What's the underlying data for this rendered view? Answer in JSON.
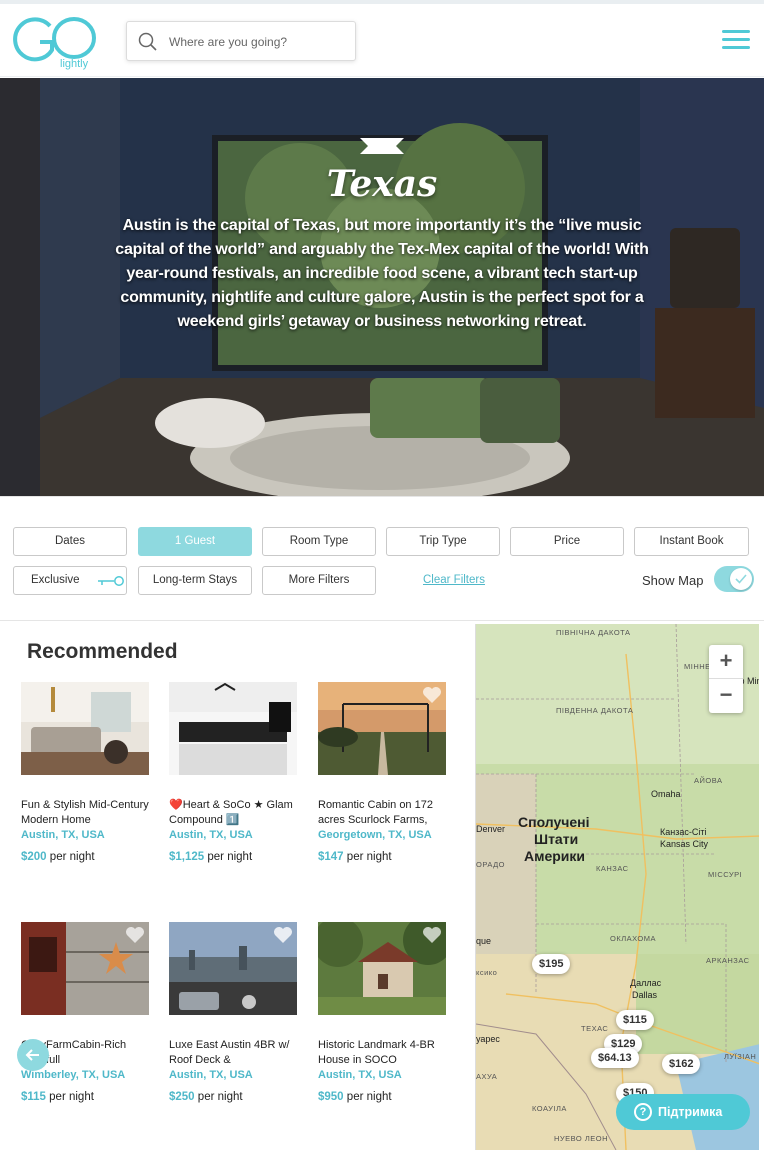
{
  "header": {
    "logo_text": "Go",
    "logo_tagline": "lightly",
    "search_placeholder": "Where are you going?"
  },
  "hero": {
    "title": "Texas",
    "description": "Austin is the capital of Texas, but more importantly it’s the “live music capital of the world” and arguably the Tex-Mex capital of the world! With year-round festivals, an incredible food scene, a vibrant tech start-up community, nightlife and culture galore, Austin is the perfect spot for a weekend girls’ getaway or business networking retreat."
  },
  "filters": {
    "dates": "Dates",
    "guests": "1 Guest",
    "room_type": "Room Type",
    "trip_type": "Trip Type",
    "price": "Price",
    "instant_book": "Instant Book",
    "exclusive": "Exclusive",
    "long_term": "Long-term Stays",
    "more_filters": "More Filters",
    "clear_filters": "Clear Filters",
    "show_map": "Show Map"
  },
  "listings": {
    "title": "Recommended",
    "per_night": "per night",
    "items": [
      {
        "name": "Fun & Stylish Mid-Century Modern Home",
        "location": "Austin, TX, USA",
        "price": "$200"
      },
      {
        "name": "❤️Heart & SoCo ★ Glam Compound 1️⃣",
        "location": "Austin, TX, USA",
        "price": "$1,125"
      },
      {
        "name": "Romantic Cabin on 172 acres Scurlock Farms,",
        "location": "Georgetown, TX, USA",
        "price": "$147"
      },
      {
        "name": "CozyFarmCabin-Rich Pets,full",
        "location": "Wimberley, TX, USA",
        "price": "$115"
      },
      {
        "name": "Luxe East Austin 4BR w/ Roof Deck &",
        "location": "Austin, TX, USA",
        "price": "$250"
      },
      {
        "name": "Historic Landmark 4-BR House in SOCO",
        "location": "Austin, TX, USA",
        "price": "$950"
      }
    ]
  },
  "map": {
    "labels": {
      "north_dakota": "ПІВНІЧНА ДАКОТА",
      "south_dakota": "ПІВДЕННА ДАКОТА",
      "minnesota_ua": "МІННЕСОТА",
      "minneapolis": "Minneap Minnes",
      "iowa": "АЙОВА",
      "omaha": "Omaha",
      "denver": "Denver",
      "usa_1": "Сполучені",
      "usa_2": "Штати",
      "usa_3": "Америки",
      "kansas_city_ua": "Канзас-Сіті",
      "kansas_city": "Kansas City",
      "kansas": "КАНЗАС",
      "missouri": "МІССУРІ",
      "colorado": "ОРАДО",
      "oklahoma": "ОКЛАХОМА",
      "arkansas": "АРКАНЗАС",
      "new_mexico": "ксико",
      "que": "que",
      "dallas_ua": "Даллас",
      "dallas": "Dallas",
      "texas": "ТЕХАС",
      "louisiana": "ЛУЇЗІАН",
      "ciudad": "уарес",
      "chihuahua": "АХУА",
      "coahuila": "КОАУІЛА",
      "nuevo_leon": "НУЕВО ЛЕОН"
    },
    "zoom_in": "+",
    "zoom_out": "−",
    "pins": [
      "$195",
      "$115",
      "$129",
      "$64.13",
      "$162",
      "$150"
    ],
    "support_label": "Підтримка"
  }
}
